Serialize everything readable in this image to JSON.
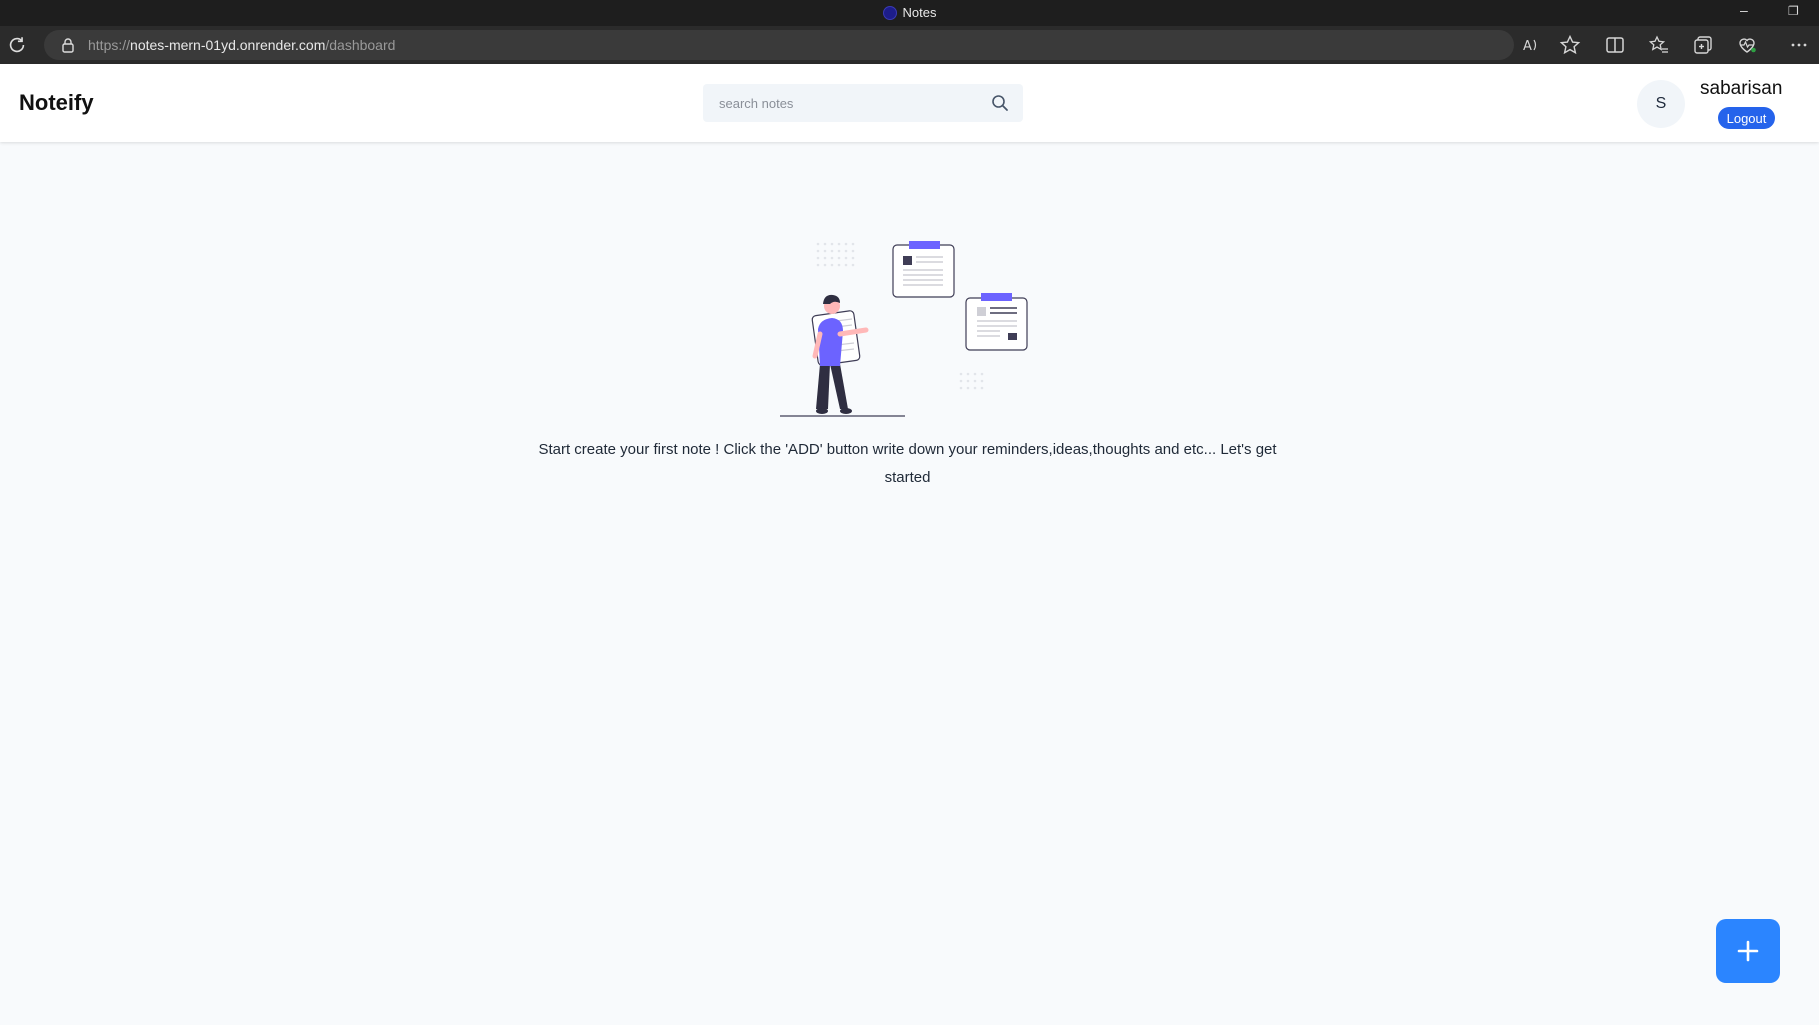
{
  "window": {
    "title": "Notes"
  },
  "browser": {
    "url_scheme": "https://",
    "url_host": "notes-mern-01yd.onrender.com",
    "url_path": "/dashboard"
  },
  "navbar": {
    "brand": "Noteify",
    "search_placeholder": "search notes",
    "avatar_initial": "S",
    "username": "sabarisan",
    "logout_label": "Logout"
  },
  "empty_state": {
    "message": "Start create your first note ! Click the 'ADD' button write down your reminders,ideas,thoughts and etc... Let's get started"
  },
  "colors": {
    "accent": "#2b85ff",
    "logout": "#2563eb",
    "illustration": "#6c63ff"
  }
}
